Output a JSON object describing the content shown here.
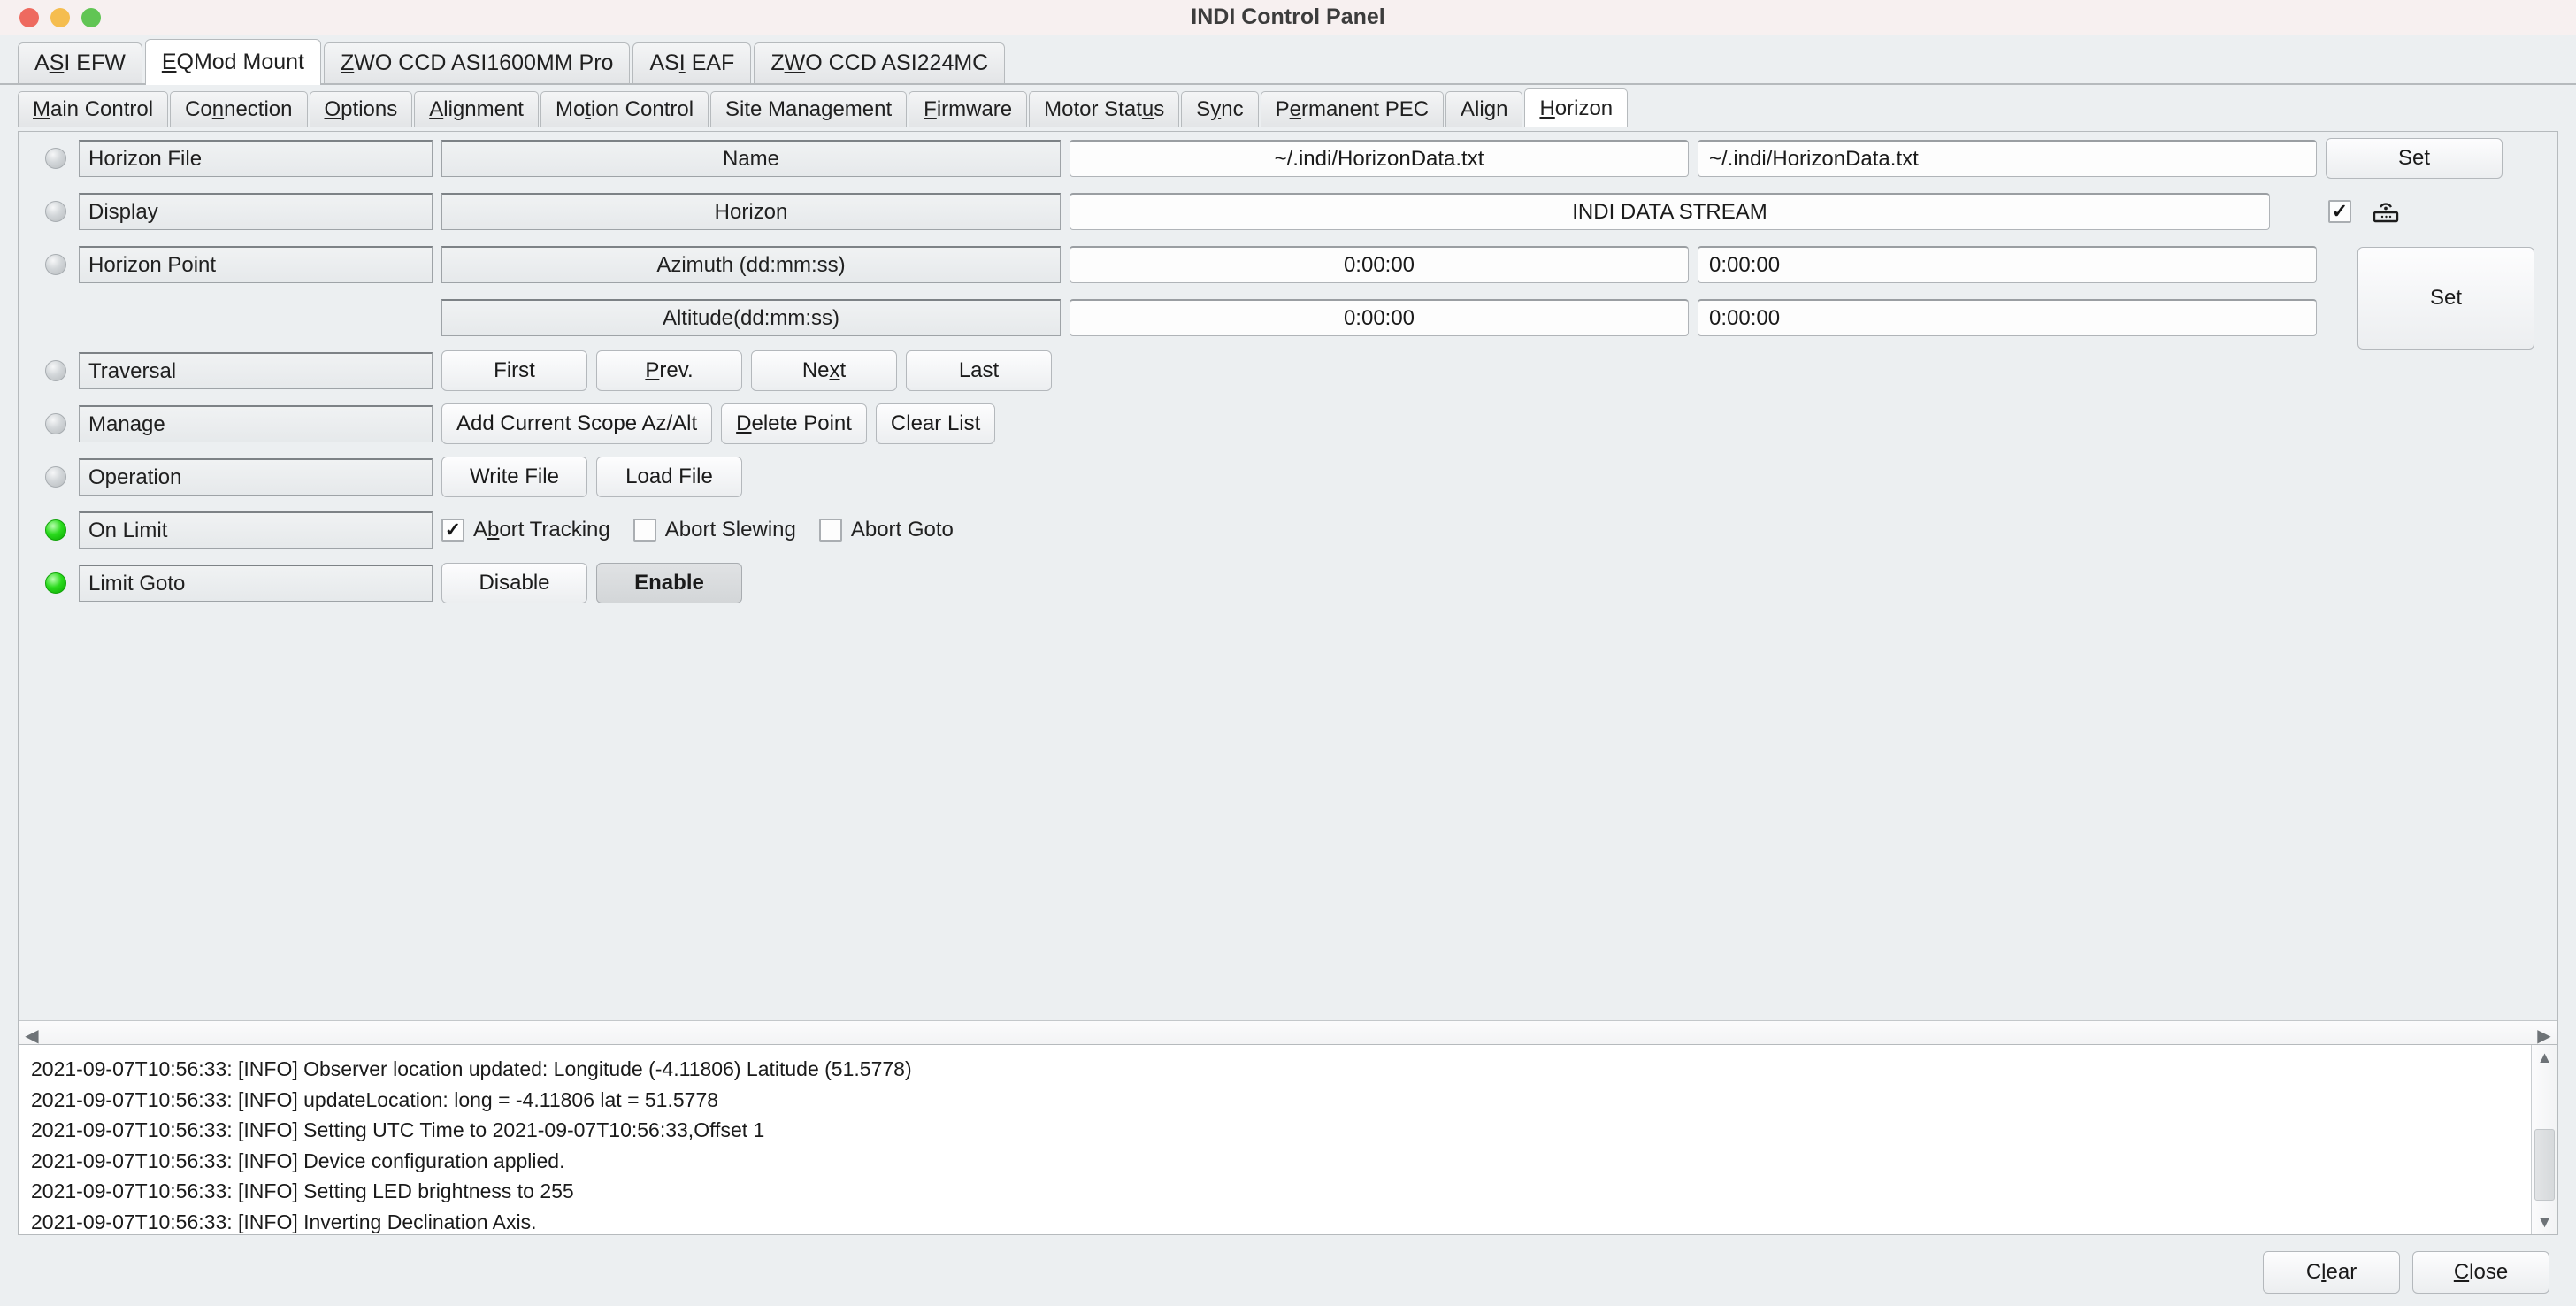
{
  "window": {
    "title": "INDI Control Panel",
    "traffic_lights": [
      "close-red",
      "minimize-yellow",
      "zoom-green"
    ]
  },
  "device_tabs": [
    {
      "label": "ASI EFW",
      "mnemonic": "SI",
      "active": false
    },
    {
      "label": "EQMod Mount",
      "mnemonic": "E",
      "active": true
    },
    {
      "label": "ZWO CCD ASI1600MM Pro",
      "mnemonic": "Z",
      "active": false
    },
    {
      "label": "ASI EAF",
      "mnemonic": "I",
      "active": false
    },
    {
      "label": "ZWO CCD ASI224MC",
      "mnemonic": "W",
      "active": false
    }
  ],
  "sub_tabs": [
    {
      "label": "Main Control",
      "active": false
    },
    {
      "label": "Connection",
      "active": false
    },
    {
      "label": "Options",
      "active": false
    },
    {
      "label": "Alignment",
      "active": false
    },
    {
      "label": "Motion Control",
      "active": false
    },
    {
      "label": "Site Management",
      "active": false
    },
    {
      "label": "Firmware",
      "active": false
    },
    {
      "label": "Motor Status",
      "active": false
    },
    {
      "label": "Sync",
      "active": false
    },
    {
      "label": "Permanent PEC",
      "active": false
    },
    {
      "label": "Align",
      "active": false
    },
    {
      "label": "Horizon",
      "active": true
    }
  ],
  "properties": {
    "horizon_file": {
      "led": "idle",
      "name": "Horizon File",
      "field_label": "Name",
      "value": "~/.indi/HorizonData.txt",
      "input_value": "~/.indi/HorizonData.txt",
      "set_label": "Set"
    },
    "display": {
      "led": "idle",
      "name": "Display",
      "field_label": "Horizon",
      "value": "INDI DATA STREAM",
      "checkbox_checked": true,
      "checkbox_glyph": "✓",
      "icon": "router-icon"
    },
    "horizon_point": {
      "led": "idle",
      "name": "Horizon Point",
      "set_label": "Set",
      "entries": [
        {
          "field_label": "Azimuth (dd:mm:ss)",
          "value": "0:00:00",
          "input_value": "0:00:00"
        },
        {
          "field_label": "Altitude(dd:mm:ss)",
          "value": "0:00:00",
          "input_value": "0:00:00"
        }
      ]
    },
    "traversal": {
      "led": "idle",
      "name": "Traversal",
      "buttons": [
        {
          "label": "First",
          "mnemonic": "",
          "active": false
        },
        {
          "label": "Prev.",
          "mnemonic": "P",
          "active": false
        },
        {
          "label": "Next",
          "mnemonic": "x",
          "active": false
        },
        {
          "label": "Last",
          "mnemonic": "",
          "active": false
        }
      ]
    },
    "manage": {
      "led": "idle",
      "name": "Manage",
      "buttons": [
        {
          "label": "Add Current Scope Az/Alt",
          "active": false
        },
        {
          "label": "Delete Point",
          "active": false
        },
        {
          "label": "Clear List",
          "active": false
        }
      ]
    },
    "operation": {
      "led": "idle",
      "name": "Operation",
      "buttons": [
        {
          "label": "Write File",
          "active": false
        },
        {
          "label": "Load File",
          "active": false
        }
      ]
    },
    "on_limit": {
      "led": "on",
      "name": "On Limit",
      "checkboxes": [
        {
          "label": "Abort Tracking",
          "checked": true
        },
        {
          "label": "Abort Slewing",
          "checked": false
        },
        {
          "label": "Abort Goto",
          "checked": false
        }
      ]
    },
    "limit_goto": {
      "led": "on",
      "name": "Limit Goto",
      "buttons": [
        {
          "label": "Disable",
          "active": false
        },
        {
          "label": "Enable",
          "active": true
        }
      ]
    }
  },
  "log": {
    "lines": [
      "2021-09-07T10:56:33: [INFO] Observer location updated: Longitude (-4.11806) Latitude (51.5778)",
      "2021-09-07T10:56:33: [INFO] updateLocation: long = -4.11806 lat = 51.5778",
      "2021-09-07T10:56:33: [INFO] Setting UTC Time to 2021-09-07T10:56:33,Offset 1",
      "2021-09-07T10:56:33: [INFO] Device configuration applied.",
      "2021-09-07T10:56:33: [INFO] Setting LED brightness to 255",
      "2021-09-07T10:56:33: [INFO] Inverting Declination Axis."
    ]
  },
  "footer": {
    "clear_label": "Clear",
    "close_label": "Close"
  },
  "colors": {
    "titlebar": "#f7f0f0",
    "background": "#eceff1",
    "led_on": "#2bdb1e",
    "led_idle": "#d2d6d9",
    "accent_active_tab": "#ffffff"
  }
}
